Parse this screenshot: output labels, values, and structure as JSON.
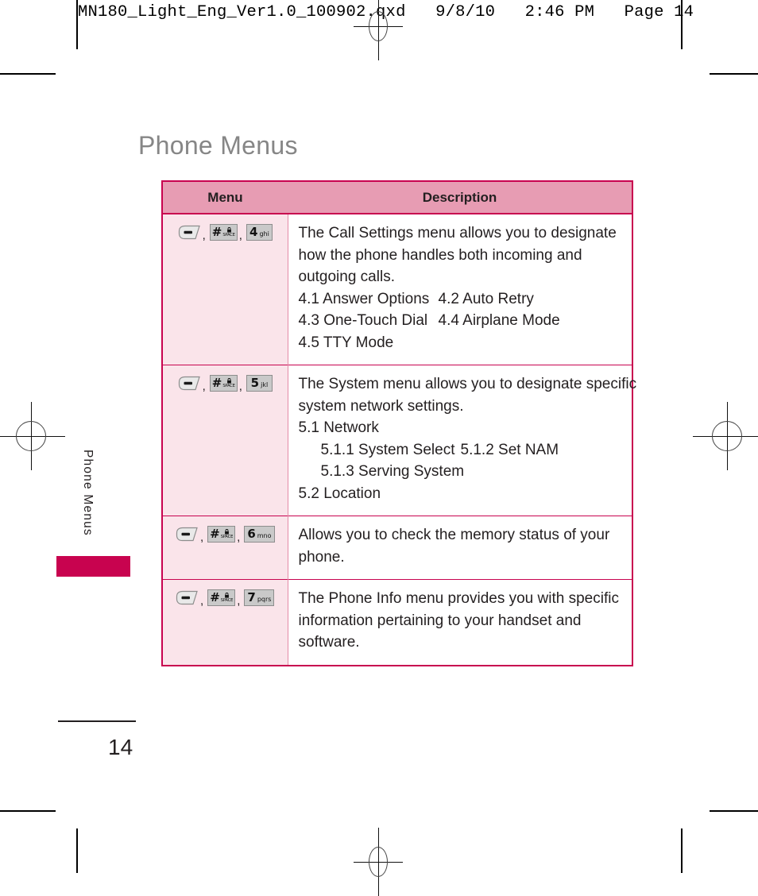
{
  "print_header": "MN180_Light_Eng_Ver1.0_100902.qxd   9/8/10   2:46 PM   Page 14",
  "page_title": "Phone Menus",
  "side_tab": {
    "label": "Phone Menus",
    "accent_color": "#c8034f"
  },
  "footer": {
    "page_number": "14"
  },
  "table": {
    "header": {
      "menu": "Menu",
      "description": "Description"
    },
    "header_bg": "#e79cb3",
    "keys_bg": "#fae4ea",
    "border_color": "#c8034f",
    "rows": [
      {
        "keys": [
          {
            "type": "softkey",
            "name": "menu-softkey"
          },
          {
            "type": "hash",
            "digit": "#",
            "sub": "SPACE",
            "lock": true
          },
          {
            "type": "numkey",
            "digit": "4",
            "letters": "ghi"
          }
        ],
        "description": {
          "paragraph": [
            "The Call Settings menu allows you to designate",
            "how the phone handles both incoming and",
            "outgoing calls."
          ],
          "submenus": [
            {
              "left": "4.1 Answer Options",
              "right": "4.2 Auto Retry"
            },
            {
              "left": "4.3 One-Touch Dial",
              "right": "4.4 Airplane Mode"
            },
            {
              "left": "4.5 TTY Mode",
              "right": ""
            }
          ]
        }
      },
      {
        "keys": [
          {
            "type": "softkey",
            "name": "menu-softkey"
          },
          {
            "type": "hash",
            "digit": "#",
            "sub": "SPACE",
            "lock": true
          },
          {
            "type": "numkey",
            "digit": "5",
            "letters": "jkl"
          }
        ],
        "description": {
          "paragraph": [
            "The System menu allows you to designate specific",
            "system network settings."
          ],
          "submenus": [
            {
              "left": "5.1 Network",
              "right": ""
            }
          ],
          "subsub": [
            {
              "left": "5.1.1 System Select",
              "right": "5.1.2 Set NAM"
            },
            {
              "left": "5.1.3 Serving System",
              "right": ""
            }
          ],
          "submenus_tail": [
            {
              "left": "5.2 Location",
              "right": ""
            }
          ]
        }
      },
      {
        "keys": [
          {
            "type": "softkey",
            "name": "menu-softkey"
          },
          {
            "type": "hash",
            "digit": "#",
            "sub": "SPACE",
            "lock": true
          },
          {
            "type": "numkey",
            "digit": "6",
            "letters": "mno"
          }
        ],
        "description": {
          "paragraph": [
            "Allows you to check the memory status of your",
            "phone."
          ],
          "submenus": [],
          "subsub": [],
          "submenus_tail": []
        }
      },
      {
        "keys": [
          {
            "type": "softkey",
            "name": "menu-softkey"
          },
          {
            "type": "hash",
            "digit": "#",
            "sub": "SPACE",
            "lock": true
          },
          {
            "type": "numkey",
            "digit": "7",
            "letters": "pqrs"
          }
        ],
        "description": {
          "paragraph": [
            "The Phone Info menu provides you with specific",
            "information pertaining to your handset and",
            "software."
          ],
          "submenus": [],
          "subsub": [],
          "submenus_tail": []
        }
      }
    ]
  }
}
